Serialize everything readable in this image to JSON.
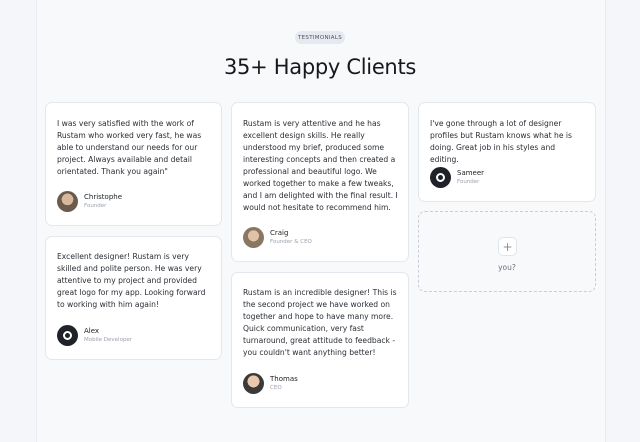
{
  "section": {
    "badge": "TESTIMONIALS",
    "title": "35+ Happy Clients"
  },
  "testimonials": [
    {
      "quote": "I was very satisfied with the work of Rustam who worked very fast, he was able to understand our needs for our project. Always available and detail orientated. Thank you again\"",
      "name": "Christophe",
      "role": "Founder",
      "avatar": "photo"
    },
    {
      "quote": "Excellent designer! Rustam is very skilled and polite person. He was very attentive to my project and provided great logo for my app. Looking forward to working with him again!",
      "name": "Alex",
      "role": "Mobile Developer",
      "avatar": "logo"
    },
    {
      "quote": "Rustam is very attentive and he has excellent design skills. He really understood my brief, produced some interesting concepts and then created a professional and beautiful logo. We worked together to make a few tweaks, and I am delighted with the final result. I would not hesitate to recommend him.",
      "name": "Craig",
      "role": "Founder & CEO",
      "avatar": "photo"
    },
    {
      "quote": "Rustam is an incredible designer! This is the second project we have worked on together and hope to have many more. Quick communication, very fast turnaround, great attitude to feedback - you couldn't want anything better!",
      "name": "Thomas",
      "role": "CEO",
      "avatar": "photo"
    },
    {
      "quote": "I've gone through a lot of designer profiles but Rustam knows what he is doing. Great job in his styles and editing.",
      "name": "Sameer",
      "role": "Founder",
      "avatar": "logo"
    }
  ],
  "add_card": {
    "icon": "plus-icon",
    "label": "you?"
  }
}
